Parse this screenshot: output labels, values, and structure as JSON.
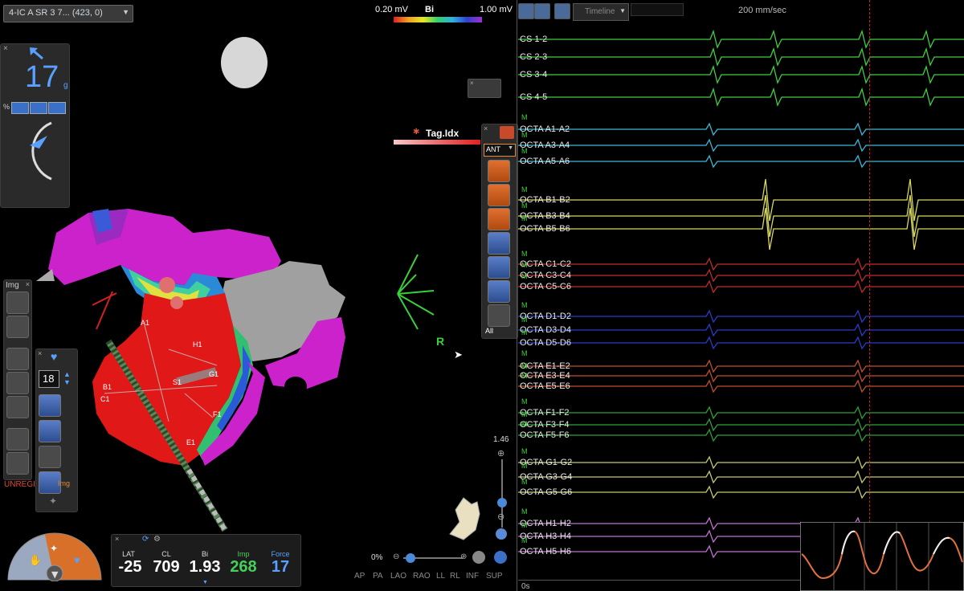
{
  "map_selector": {
    "label": "4-IC A SR 3 7...  (423, 0)"
  },
  "scale": {
    "min_label": "0.20 mV",
    "max_label": "1.00 mV",
    "mode": "Bi"
  },
  "force_widget": {
    "value": "17",
    "unit": "g",
    "percent_symbol": "%"
  },
  "tag_index": {
    "label": "Tag.Idx"
  },
  "view_dropdown": {
    "value": "ANT"
  },
  "tag_filter": {
    "label": "All"
  },
  "orientation": {
    "label": "R"
  },
  "zoom": {
    "value_label": "1.46",
    "percent_label": "0%"
  },
  "img_panel": {
    "title": "Img",
    "unregistered": "UNREGIS",
    "img_link": "Img"
  },
  "counter_panel": {
    "value": "18"
  },
  "view_buttons": [
    "AP",
    "PA",
    "LAO",
    "RAO",
    "LL",
    "RL",
    "INF",
    "SUP"
  ],
  "readouts": [
    {
      "label": "LAT",
      "value": "-25",
      "color": "#ffffff"
    },
    {
      "label": "CL",
      "value": "709",
      "color": "#ffffff"
    },
    {
      "label": "Bi",
      "value": "1.93",
      "color": "#ffffff"
    },
    {
      "label": "Imp",
      "value": "268",
      "color": "#46d05a"
    },
    {
      "label": "Force",
      "value": "17",
      "color": "#5aa0ff"
    }
  ],
  "ecg_toolbar": {
    "timeline_label": "Timeline",
    "speed": "200 mm/sec",
    "time_zero": "0s"
  },
  "catheter_labels": [
    "A1",
    "H1",
    "B1",
    "C1",
    "G1",
    "S1",
    "F1",
    "E1"
  ],
  "channels": [
    {
      "label": "CS 1-2",
      "color": "#3fcf3f",
      "m": false
    },
    {
      "label": "CS 2-3",
      "color": "#3fcf3f",
      "m": false
    },
    {
      "label": "CS 3-4",
      "color": "#3fcf3f",
      "m": false
    },
    {
      "label": "CS 4-5",
      "color": "#3fcf3f",
      "m": false
    },
    {
      "label": "OCTA A1-A2",
      "color": "#3ab8d8",
      "m": true
    },
    {
      "label": "OCTA A3-A4",
      "color": "#3ab8d8",
      "m": true
    },
    {
      "label": "OCTA A5-A6",
      "color": "#3ab8d8",
      "m": true
    },
    {
      "label": "OCTA B1-B2",
      "color": "#d8d860",
      "m": true
    },
    {
      "label": "OCTA B3-B4",
      "color": "#d8d860",
      "m": true
    },
    {
      "label": "OCTA B5-B6",
      "color": "#d8d860",
      "m": true
    },
    {
      "label": "OCTA C1-C2",
      "color": "#c02c2c",
      "m": true
    },
    {
      "label": "OCTA C3-C4",
      "color": "#c02c2c",
      "m": true
    },
    {
      "label": "OCTA C5-C6",
      "color": "#c02c2c",
      "m": true
    },
    {
      "label": "OCTA D1-D2",
      "color": "#2a3cc8",
      "m": true
    },
    {
      "label": "OCTA D3-D4",
      "color": "#2a3cc8",
      "m": true
    },
    {
      "label": "OCTA D5-D6",
      "color": "#2a3cc8",
      "m": true
    },
    {
      "label": "OCTA E1-E2",
      "color": "#c0502c",
      "m": true
    },
    {
      "label": "OCTA E3-E4",
      "color": "#c0502c",
      "m": true
    },
    {
      "label": "OCTA E5-E6",
      "color": "#c0502c",
      "m": true
    },
    {
      "label": "OCTA F1-F2",
      "color": "#2ea03a",
      "m": true
    },
    {
      "label": "OCTA F3-F4",
      "color": "#2ea03a",
      "m": true
    },
    {
      "label": "OCTA F5-F6",
      "color": "#2ea03a",
      "m": true
    },
    {
      "label": "OCTA G1-G2",
      "color": "#c8c870",
      "m": true
    },
    {
      "label": "OCTA G3-G4",
      "color": "#c8c870",
      "m": true
    },
    {
      "label": "OCTA G5-G6",
      "color": "#c8c870",
      "m": true
    },
    {
      "label": "OCTA H1-H2",
      "color": "#c070d0",
      "m": true
    },
    {
      "label": "OCTA H3-H4",
      "color": "#c070d0",
      "m": true
    },
    {
      "label": "OCTA H5-H6",
      "color": "#c070d0",
      "m": true
    }
  ]
}
